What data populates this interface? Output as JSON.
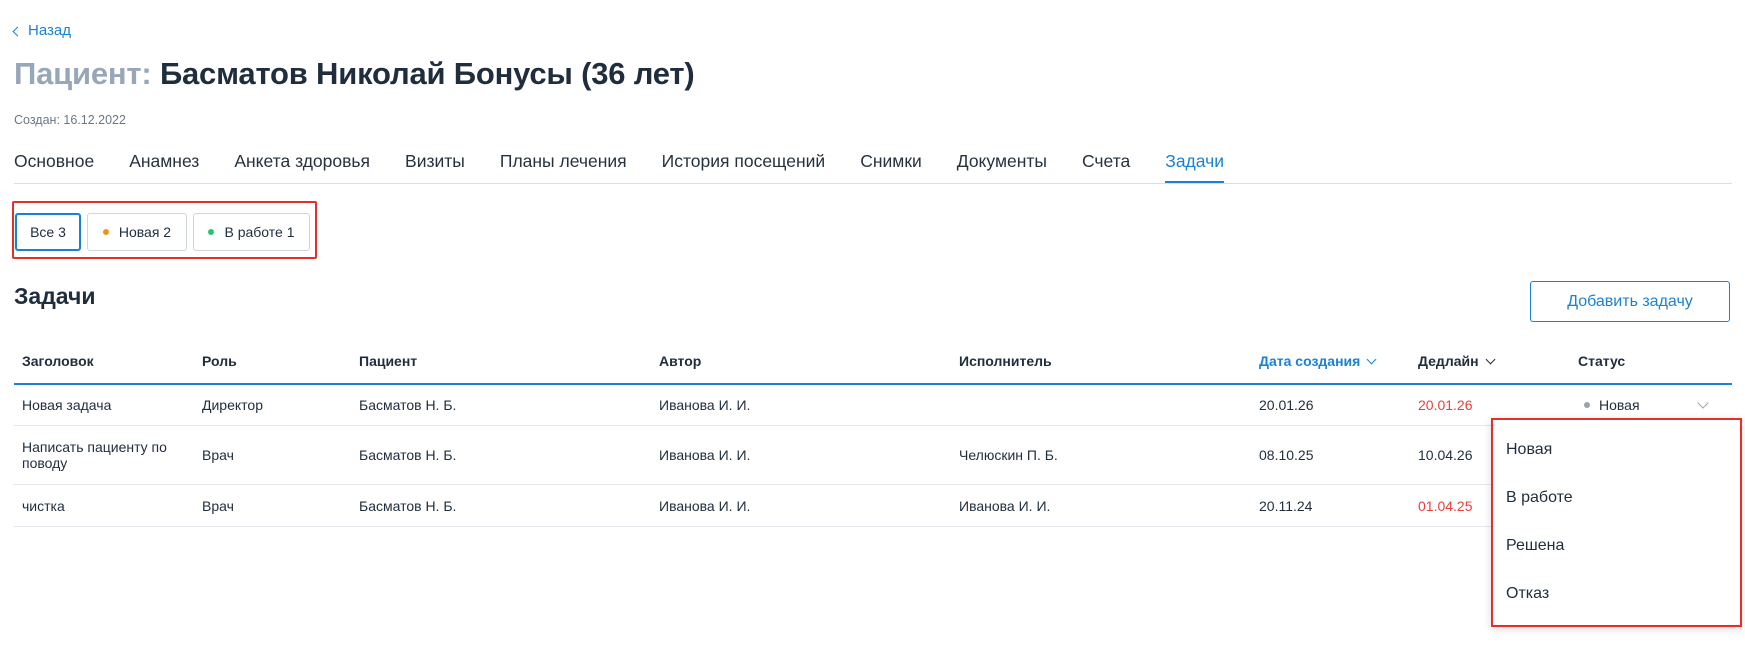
{
  "back": {
    "label": "Назад"
  },
  "header": {
    "prefix": "Пациент:",
    "patient": "Басматов Николай Бонусы (36 лет)",
    "created": "Создан: 16.12.2022"
  },
  "tabs": [
    {
      "label": "Основное"
    },
    {
      "label": "Анамнез"
    },
    {
      "label": "Анкета здоровья"
    },
    {
      "label": "Визиты"
    },
    {
      "label": "Планы лечения"
    },
    {
      "label": "История посещений"
    },
    {
      "label": "Снимки"
    },
    {
      "label": "Документы"
    },
    {
      "label": "Счета"
    },
    {
      "label": "Задачи",
      "active": true
    }
  ],
  "filters": {
    "all": "Все 3",
    "new": "Новая 2",
    "in_progress": "В работе 1",
    "new_color": "#f0931c",
    "in_progress_color": "#27c56a"
  },
  "section": {
    "title": "Задачи",
    "add_button": "Добавить задачу"
  },
  "table": {
    "headers": {
      "title": "Заголовок",
      "role": "Роль",
      "patient": "Пациент",
      "author": "Автор",
      "assignee": "Исполнитель",
      "created": "Дата создания",
      "deadline": "Дедлайн",
      "status": "Статус"
    },
    "rows": [
      {
        "title": "Новая задача",
        "role": "Директор",
        "patient": "Басматов Н. Б.",
        "author": "Иванова И. И.",
        "assignee": "",
        "created": "20.01.26",
        "deadline": "20.01.26",
        "deadline_overdue": true,
        "status": "Новая"
      },
      {
        "title": "Написать пациенту по поводу",
        "role": "Врач",
        "patient": "Басматов Н. Б.",
        "author": "Иванова И. И.",
        "assignee": "Челюскин П. Б.",
        "created": "08.10.25",
        "deadline": "10.04.26",
        "deadline_overdue": false
      },
      {
        "title": "чистка",
        "role": "Врач",
        "patient": "Басматов Н. Б.",
        "author": "Иванова И. И.",
        "assignee": "Иванова И. И.",
        "created": "20.11.24",
        "deadline": "01.04.25",
        "deadline_overdue": true
      }
    ]
  },
  "status_dropdown": {
    "options": [
      "Новая",
      "В работе",
      "Решена",
      "Отказ"
    ]
  },
  "colors": {
    "accent": "#1a82d3",
    "overdue": "#e8413c",
    "highlight": "#e3302a"
  }
}
